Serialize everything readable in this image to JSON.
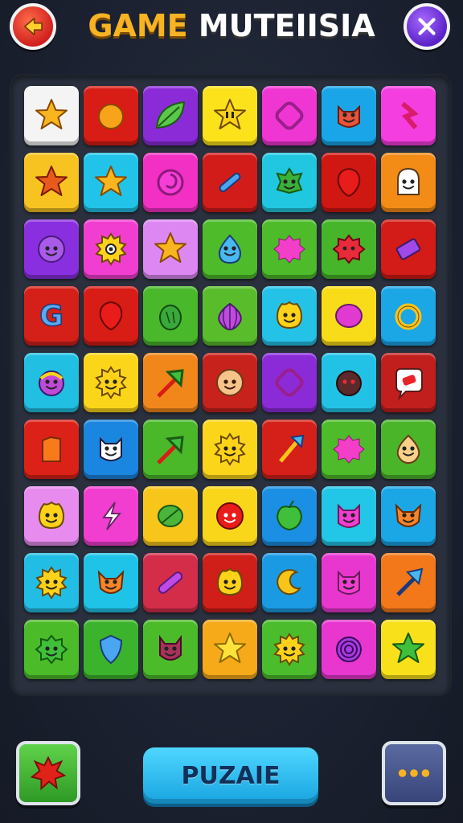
{
  "header": {
    "title_part1": "GAME",
    "title_part2": "MUTEIISIA",
    "back_icon": "arrow-left-icon",
    "close_icon": "close-icon"
  },
  "board": {
    "rows": 9,
    "cols": 7,
    "tiles": [
      [
        {
          "color": "#f4f4f4",
          "icon": "star"
        },
        {
          "color": "#d81c16",
          "icon": "orange-blob"
        },
        {
          "color": "#8b2bd8",
          "icon": "leaf"
        },
        {
          "color": "#fce21a",
          "icon": "star-face"
        },
        {
          "color": "#f036d2",
          "icon": "gem"
        },
        {
          "color": "#1aa5e8",
          "icon": "cat-face"
        },
        {
          "color": "#f53ee0",
          "icon": "bolt"
        }
      ],
      [
        {
          "color": "#f6c320",
          "icon": "star-red"
        },
        {
          "color": "#22c3e8",
          "icon": "star"
        },
        {
          "color": "#f230c4",
          "icon": "swirl"
        },
        {
          "color": "#d21c1a",
          "icon": "rod"
        },
        {
          "color": "#21c7e0",
          "icon": "monster"
        },
        {
          "color": "#d01813",
          "icon": "balloon"
        },
        {
          "color": "#f38b17",
          "icon": "ghost"
        }
      ],
      [
        {
          "color": "#8a2fe0",
          "icon": "purple-face"
        },
        {
          "color": "#f23ed0",
          "icon": "sun-eye"
        },
        {
          "color": "#dd88f2",
          "icon": "star"
        },
        {
          "color": "#4dbb2a",
          "icon": "drop-face"
        },
        {
          "color": "#4dbb2a",
          "icon": "pink-blob"
        },
        {
          "color": "#46b529",
          "icon": "red-blob"
        },
        {
          "color": "#d31b17",
          "icon": "purple-gem"
        }
      ],
      [
        {
          "color": "#d42019",
          "icon": "g-letter"
        },
        {
          "color": "#d81c16",
          "icon": "balloon"
        },
        {
          "color": "#49b82b",
          "icon": "pickle"
        },
        {
          "color": "#59bd2b",
          "icon": "onion"
        },
        {
          "color": "#25c2e8",
          "icon": "yellow-face"
        },
        {
          "color": "#f8dc19",
          "icon": "magenta-ball"
        },
        {
          "color": "#1ba6e6",
          "icon": "ring"
        }
      ],
      [
        {
          "color": "#21bfe2",
          "icon": "rainbow-face"
        },
        {
          "color": "#fbd51a",
          "icon": "sun-face"
        },
        {
          "color": "#f1871a",
          "icon": "arrow"
        },
        {
          "color": "#c8221d",
          "icon": "skin-face"
        },
        {
          "color": "#8b2bd8",
          "icon": "gem"
        },
        {
          "color": "#22c2e6",
          "icon": "dark-face"
        },
        {
          "color": "#c11f1e",
          "icon": "chat"
        }
      ],
      [
        {
          "color": "#dc2218",
          "icon": "orange-block"
        },
        {
          "color": "#1a86e0",
          "icon": "ghost-cat"
        },
        {
          "color": "#4bb82a",
          "icon": "arrow"
        },
        {
          "color": "#fbd51a",
          "icon": "sun-face"
        },
        {
          "color": "#d42019",
          "icon": "sword"
        },
        {
          "color": "#4dbb2a",
          "icon": "pink-blob"
        },
        {
          "color": "#4bb52a",
          "icon": "onion-face"
        }
      ],
      [
        {
          "color": "#e88bee",
          "icon": "yellow-face"
        },
        {
          "color": "#f23ed0",
          "icon": "bolt-white"
        },
        {
          "color": "#f8c61b",
          "icon": "leaf-green"
        },
        {
          "color": "#f9d61a",
          "icon": "red-face"
        },
        {
          "color": "#1b8fe4",
          "icon": "apple"
        },
        {
          "color": "#22c6e6",
          "icon": "pink-cat"
        },
        {
          "color": "#1ba6e6",
          "icon": "fox"
        }
      ],
      [
        {
          "color": "#22bde4",
          "icon": "sun-face"
        },
        {
          "color": "#20c3e8",
          "icon": "fox"
        },
        {
          "color": "#d42d4a",
          "icon": "rod-purple"
        },
        {
          "color": "#d01e19",
          "icon": "yellow-face"
        },
        {
          "color": "#1b9ae4",
          "icon": "moon"
        },
        {
          "color": "#e737cf",
          "icon": "pink-cat"
        },
        {
          "color": "#f2781a",
          "icon": "arrow-blue"
        }
      ],
      [
        {
          "color": "#4cbb2a",
          "icon": "green-face"
        },
        {
          "color": "#3cb32c",
          "icon": "shield"
        },
        {
          "color": "#4cbb2a",
          "icon": "devil"
        },
        {
          "color": "#f6a919",
          "icon": "star-yellow"
        },
        {
          "color": "#4bbd2c",
          "icon": "sun-face"
        },
        {
          "color": "#e737cf",
          "icon": "spiral"
        },
        {
          "color": "#f8e11b",
          "icon": "star-green"
        }
      ]
    ]
  },
  "footer": {
    "power_icon": "red-splat-icon",
    "main_button_label": "PUZAIE",
    "more_icon": "more-dots-icon"
  }
}
